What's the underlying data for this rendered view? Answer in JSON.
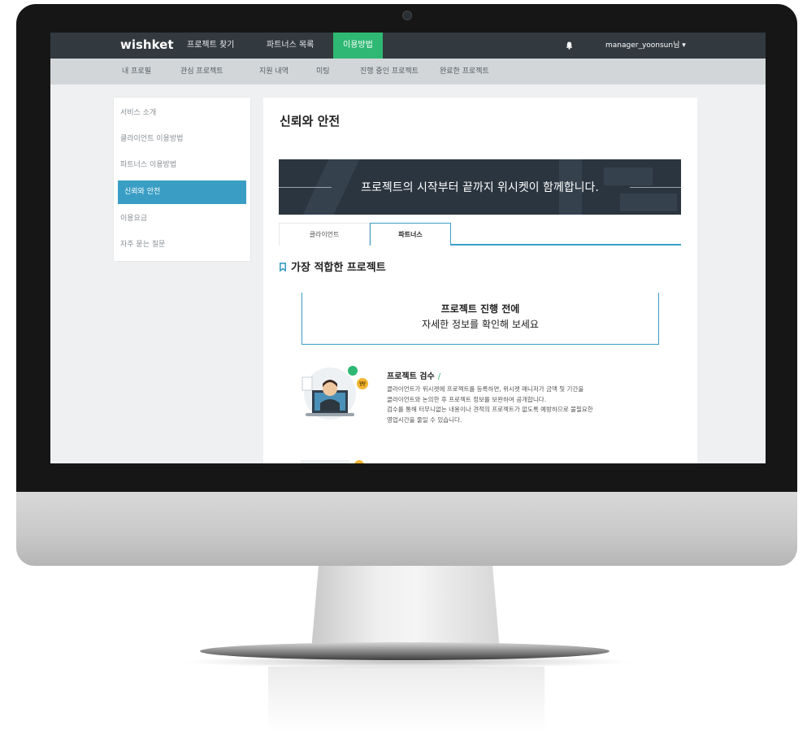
{
  "topnav": {
    "logo": "wishket",
    "items": [
      {
        "label": "프로젝트 찾기"
      },
      {
        "label": "파트너스 목록"
      },
      {
        "label": "이용방법"
      }
    ],
    "active_color": "#2fb873",
    "user": "manager_yoonsun님 ▾"
  },
  "subnav": {
    "items": [
      {
        "label": "내 프로필"
      },
      {
        "label": "관심 프로젝트"
      },
      {
        "label": "지원 내역"
      },
      {
        "label": "미팅"
      },
      {
        "label": "진행 중인 프로젝트"
      },
      {
        "label": "완료한 프로젝트"
      }
    ]
  },
  "sidebar": {
    "items": [
      {
        "label": "서비스 소개"
      },
      {
        "label": "클라이언트 이용방법"
      },
      {
        "label": "파트너스 이용방법"
      },
      {
        "label": "신뢰와 안전"
      },
      {
        "label": "이용요금"
      },
      {
        "label": "자주 묻는 질문"
      }
    ],
    "active_color": "#3a9ec4"
  },
  "main": {
    "title": "신뢰와 안전",
    "banner_text": "프로젝트의 시작부터 끝까지 위시켓이 함께합니다.",
    "tabs": [
      {
        "label": "클라이언트"
      },
      {
        "label": "파트너스"
      }
    ],
    "section_heading": "가장 적합한 프로젝트",
    "notice": {
      "line1": "프로젝트 진행 전에",
      "line2": "자세한 정보를 확인해 보세요"
    },
    "feature": {
      "title": "프로젝트 검수",
      "slash": "/",
      "lines": [
        "클라이언트가 위시켓에 프로젝트를 등록하면, 위시켓 매니저가 금액 및 기간을",
        "클라이언트와 논의한 후 프로젝트 정보를 보완하여 공개합니다.",
        "검수를 통해 터무니없는 내용이나 견적의 프로젝트가 없도록 예방하므로 불필요한",
        "영업시간을 줄일 수 있습니다."
      ]
    }
  }
}
